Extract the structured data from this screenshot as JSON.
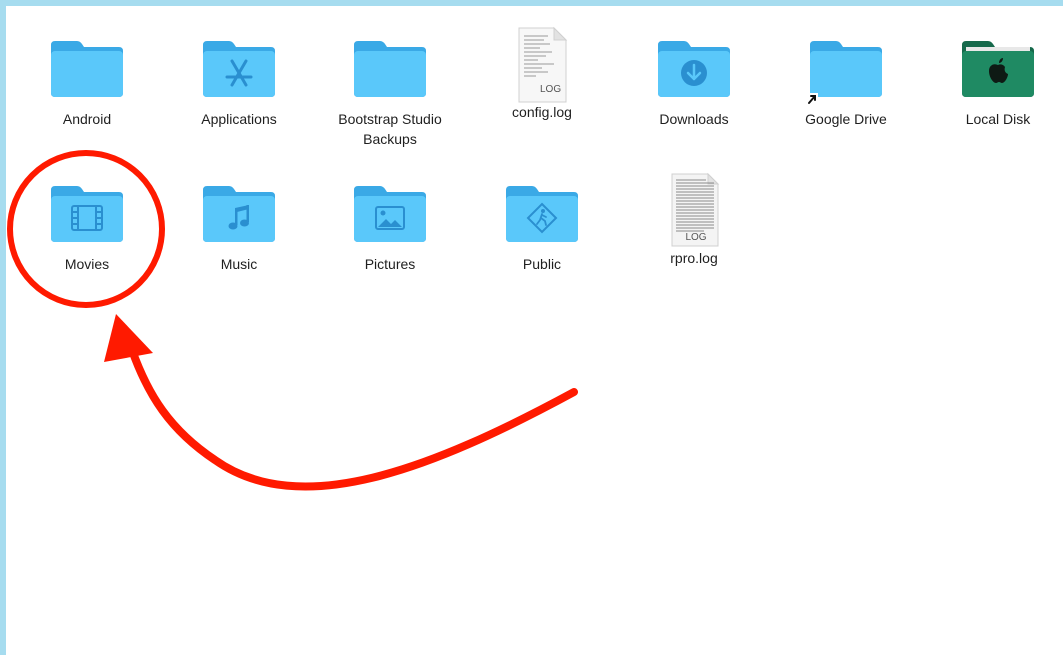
{
  "items": [
    {
      "label": "Android",
      "kind": "folder",
      "glyph": "none"
    },
    {
      "label": "Applications",
      "kind": "folder",
      "glyph": "app-store-icon"
    },
    {
      "label": "Bootstrap Studio\nBackups",
      "kind": "folder",
      "glyph": "none"
    },
    {
      "label": "config.log",
      "kind": "log-file",
      "glyph": "log-document-icon",
      "badge": "LOG"
    },
    {
      "label": "Downloads",
      "kind": "folder",
      "glyph": "download-arrow-icon"
    },
    {
      "label": "Google Drive",
      "kind": "folder-alias",
      "glyph": "alias-arrow-icon"
    },
    {
      "label": "Local Disk",
      "kind": "folder",
      "glyph": "apple-logo-icon",
      "color": "#1f7f5c"
    },
    {
      "label": "Movies",
      "kind": "folder",
      "glyph": "film-strip-icon"
    },
    {
      "label": "Music",
      "kind": "folder",
      "glyph": "music-note-icon"
    },
    {
      "label": "Pictures",
      "kind": "folder",
      "glyph": "photo-icon"
    },
    {
      "label": "Public",
      "kind": "folder",
      "glyph": "public-sign-icon"
    },
    {
      "label": "rpro.log",
      "kind": "log-file",
      "glyph": "log-document-icon",
      "badge": "LOG"
    }
  ],
  "colors": {
    "folder": "#5ac8fa",
    "folder_tab": "#45b3ea",
    "annotation": "#ff1a00",
    "frame": "#a6dcef"
  }
}
